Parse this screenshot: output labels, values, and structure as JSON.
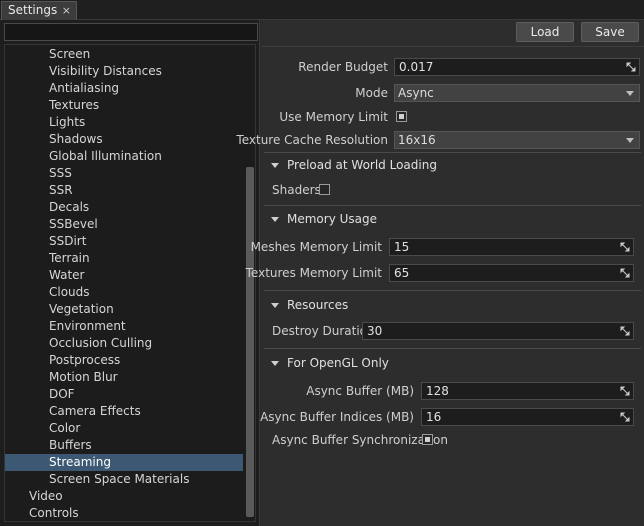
{
  "tab": {
    "title": "Settings",
    "close_glyph": "×"
  },
  "search": {
    "value": "",
    "placeholder": ""
  },
  "tree": {
    "items": [
      {
        "label": "Screen",
        "level": "child"
      },
      {
        "label": "Visibility Distances",
        "level": "child"
      },
      {
        "label": "Antialiasing",
        "level": "child"
      },
      {
        "label": "Textures",
        "level": "child"
      },
      {
        "label": "Lights",
        "level": "child"
      },
      {
        "label": "Shadows",
        "level": "child"
      },
      {
        "label": "Global Illumination",
        "level": "child"
      },
      {
        "label": "SSS",
        "level": "child"
      },
      {
        "label": "SSR",
        "level": "child"
      },
      {
        "label": "Decals",
        "level": "child"
      },
      {
        "label": "SSBevel",
        "level": "child"
      },
      {
        "label": "SSDirt",
        "level": "child"
      },
      {
        "label": "Terrain",
        "level": "child"
      },
      {
        "label": "Water",
        "level": "child"
      },
      {
        "label": "Clouds",
        "level": "child"
      },
      {
        "label": "Vegetation",
        "level": "child"
      },
      {
        "label": "Environment",
        "level": "child"
      },
      {
        "label": "Occlusion Culling",
        "level": "child"
      },
      {
        "label": "Postprocess",
        "level": "child"
      },
      {
        "label": "Motion Blur",
        "level": "child"
      },
      {
        "label": "DOF",
        "level": "child"
      },
      {
        "label": "Camera Effects",
        "level": "child"
      },
      {
        "label": "Color",
        "level": "child"
      },
      {
        "label": "Buffers",
        "level": "child"
      },
      {
        "label": "Streaming",
        "level": "child",
        "selected": true
      },
      {
        "label": "Screen Space Materials",
        "level": "child"
      },
      {
        "label": "Video",
        "level": "root"
      },
      {
        "label": "Controls",
        "level": "root"
      }
    ]
  },
  "toolbar": {
    "load_label": "Load",
    "save_label": "Save"
  },
  "settings": {
    "render_budget": {
      "label": "Render Budget",
      "value": "0.017"
    },
    "mode": {
      "label": "Mode",
      "value": "Async"
    },
    "use_memory_limit": {
      "label": "Use Memory Limit",
      "checked": true
    },
    "texture_cache_resolution": {
      "label": "Texture Cache Resolution",
      "value": "16x16"
    }
  },
  "sections": {
    "preload": {
      "title": "Preload at World Loading",
      "shaders_label": "Shaders",
      "shaders_checked": false
    },
    "memory": {
      "title": "Memory Usage",
      "meshes_label": "Meshes Memory Limit",
      "meshes_value": "15",
      "textures_label": "Textures Memory Limit",
      "textures_value": "65"
    },
    "resources": {
      "title": "Resources",
      "destroy_label": "Destroy Duration",
      "destroy_value": "30"
    },
    "opengl": {
      "title": "For OpenGL Only",
      "async_buffer_label": "Async Buffer (MB)",
      "async_buffer_value": "128",
      "async_indices_label": "Async Buffer Indices (MB)",
      "async_indices_value": "16",
      "async_sync_label": "Async Buffer Synchronization",
      "async_sync_checked": true
    }
  },
  "colors": {
    "selection": "#3c5873",
    "panel": "#2d2d2d",
    "tree_bg": "#1c1c1c"
  }
}
